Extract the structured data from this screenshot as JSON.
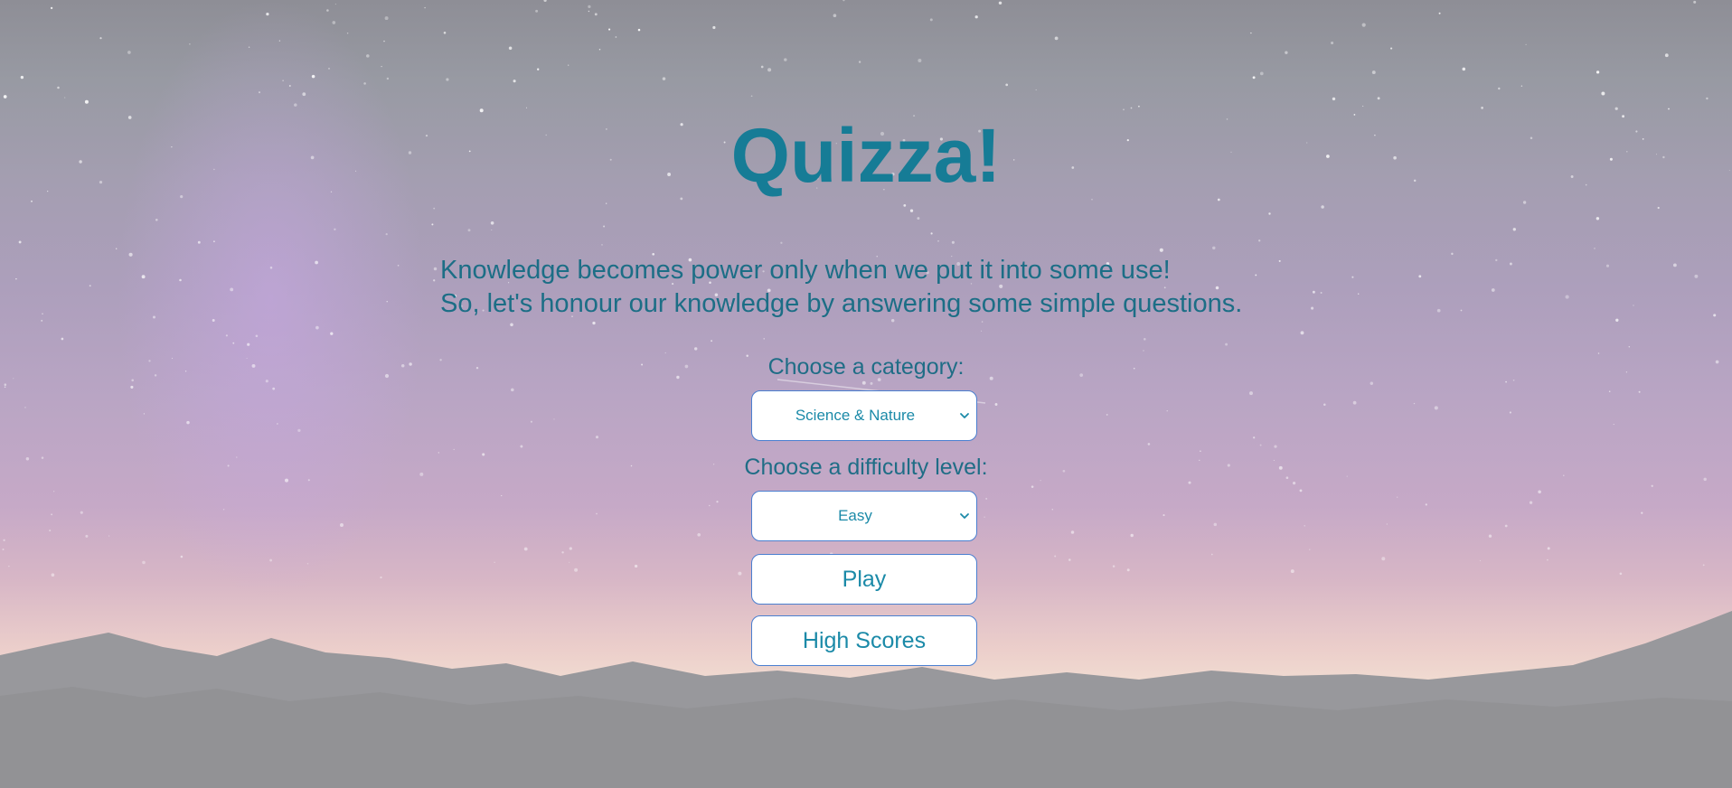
{
  "app": {
    "title": "Quizza!",
    "intro_line1": "Knowledge becomes power only when we put it into some use!",
    "intro_line2": "So, let's honour our knowledge by answering some simple questions."
  },
  "category": {
    "label": "Choose a category:",
    "selected": "Science & Nature"
  },
  "difficulty": {
    "label": "Choose a difficulty level:",
    "selected": "Easy"
  },
  "buttons": {
    "play": "Play",
    "high_scores": "High Scores"
  },
  "colors": {
    "accent": "#167c96",
    "text": "#1c6e86",
    "border": "#4a7fd0"
  },
  "icons": {
    "dropdown": "chevron-down-icon"
  }
}
